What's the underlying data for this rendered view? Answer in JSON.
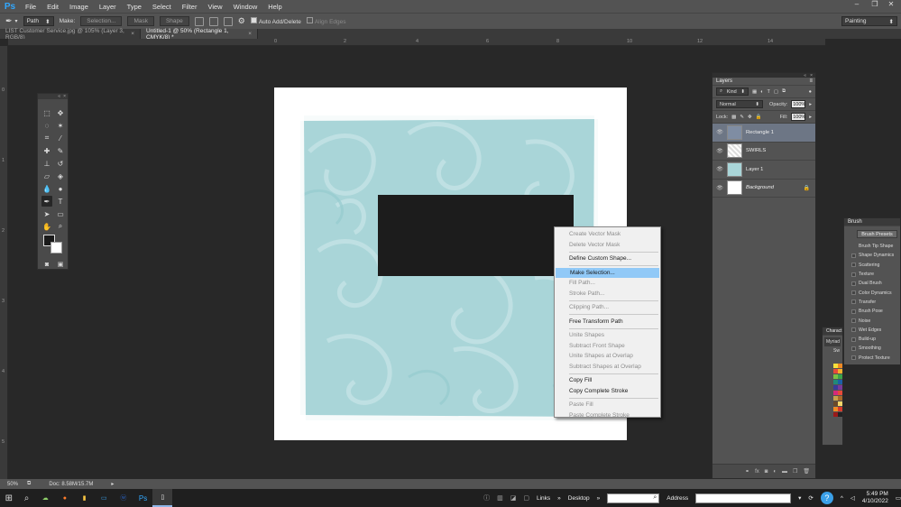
{
  "app": {
    "logo": "Ps"
  },
  "menu": [
    "File",
    "Edit",
    "Image",
    "Layer",
    "Type",
    "Select",
    "Filter",
    "View",
    "Window",
    "Help"
  ],
  "window_controls": {
    "minimize": "–",
    "restore": "❐",
    "close": "✕"
  },
  "options_bar": {
    "tool_mode": "Path",
    "make_label": "Make:",
    "selection_btn": "Selection...",
    "mask_btn": "Mask",
    "shape_btn": "Shape",
    "auto_add_delete": "Auto Add/Delete",
    "align_edges": "Align Edges",
    "workspace": "Painting"
  },
  "tabs": [
    {
      "label": "LIST Customer Service.jpg @ 105% (Layer 3, RGB/8)",
      "active": false
    },
    {
      "label": "Untitled-1 @ 50% (Rectangle 1, CMYK/8) *",
      "active": true
    }
  ],
  "ruler_top": [
    "0",
    "2",
    "4",
    "6",
    "8",
    "10",
    "12",
    "14"
  ],
  "ruler_left": [
    "0",
    "1",
    "2",
    "3",
    "4",
    "5"
  ],
  "context_menu": [
    {
      "label": "Create Vector Mask",
      "state": "disabled"
    },
    {
      "label": "Delete Vector Mask",
      "state": "disabled"
    },
    {
      "sep": true
    },
    {
      "label": "Define Custom Shape...",
      "state": "enabled"
    },
    {
      "sep": true
    },
    {
      "label": "Make Selection...",
      "state": "highlight"
    },
    {
      "label": "Fill Path...",
      "state": "disabled"
    },
    {
      "label": "Stroke Path...",
      "state": "disabled"
    },
    {
      "sep": true
    },
    {
      "label": "Clipping Path...",
      "state": "disabled"
    },
    {
      "sep": true
    },
    {
      "label": "Free Transform Path",
      "state": "enabled"
    },
    {
      "sep": true
    },
    {
      "label": "Unite Shapes",
      "state": "disabled"
    },
    {
      "label": "Subtract Front Shape",
      "state": "disabled"
    },
    {
      "label": "Unite Shapes at Overlap",
      "state": "disabled"
    },
    {
      "label": "Subtract Shapes at Overlap",
      "state": "disabled"
    },
    {
      "sep": true
    },
    {
      "label": "Copy Fill",
      "state": "enabled"
    },
    {
      "label": "Copy Complete Stroke",
      "state": "enabled"
    },
    {
      "sep": true
    },
    {
      "label": "Paste Fill",
      "state": "disabled"
    },
    {
      "label": "Paste Complete Stroke",
      "state": "disabled"
    }
  ],
  "layers_panel": {
    "title": "Layers",
    "kind": "Kind",
    "blend_mode": "Normal",
    "opacity_label": "Opacity:",
    "opacity": "100%",
    "lock_label": "Lock:",
    "fill_label": "Fill:",
    "fill": "100%",
    "layers": [
      {
        "name": "Rectangle 1",
        "selected": true,
        "thumb": "vector",
        "locked": false,
        "italic": false
      },
      {
        "name": "SWIRLS",
        "selected": false,
        "thumb": "swirl",
        "locked": false,
        "italic": false
      },
      {
        "name": "Layer 1",
        "selected": false,
        "thumb": "teal",
        "locked": false,
        "italic": false
      },
      {
        "name": "Background",
        "selected": false,
        "thumb": "white",
        "locked": true,
        "italic": true
      }
    ],
    "bottom_icons": [
      "link-icon",
      "fx-icon",
      "mask-icon",
      "adjustment-icon",
      "folder-icon",
      "new-layer-icon",
      "trash-icon"
    ]
  },
  "brush_panel": {
    "title": "Brush",
    "presets_btn": "Brush Presets",
    "items": [
      "Brush Tip Shape",
      "Shape Dynamics",
      "Scattering",
      "Texture",
      "Dual Brush",
      "Color Dynamics",
      "Transfer",
      "Brush Pose",
      "Noise",
      "Wet Edges",
      "Build-up",
      "Smoothing",
      "Protect Texture"
    ]
  },
  "char_panel": {
    "title": "Charact",
    "font": "Myriad",
    "swatch_label": "Sw"
  },
  "status_bar": {
    "zoom": "50%",
    "doc": "Doc: 8.58M/15.7M"
  },
  "taskbar": {
    "links": "Links",
    "desktop": "Desktop",
    "address": "Address",
    "time": "5:49 PM",
    "date": "4/10/2022"
  },
  "colors": {
    "accent_selection": "#91c9f7",
    "swirl_teal": "#a9d5d8",
    "rectangle": "#1c1c1c",
    "layer_selected": "#6d7685"
  }
}
